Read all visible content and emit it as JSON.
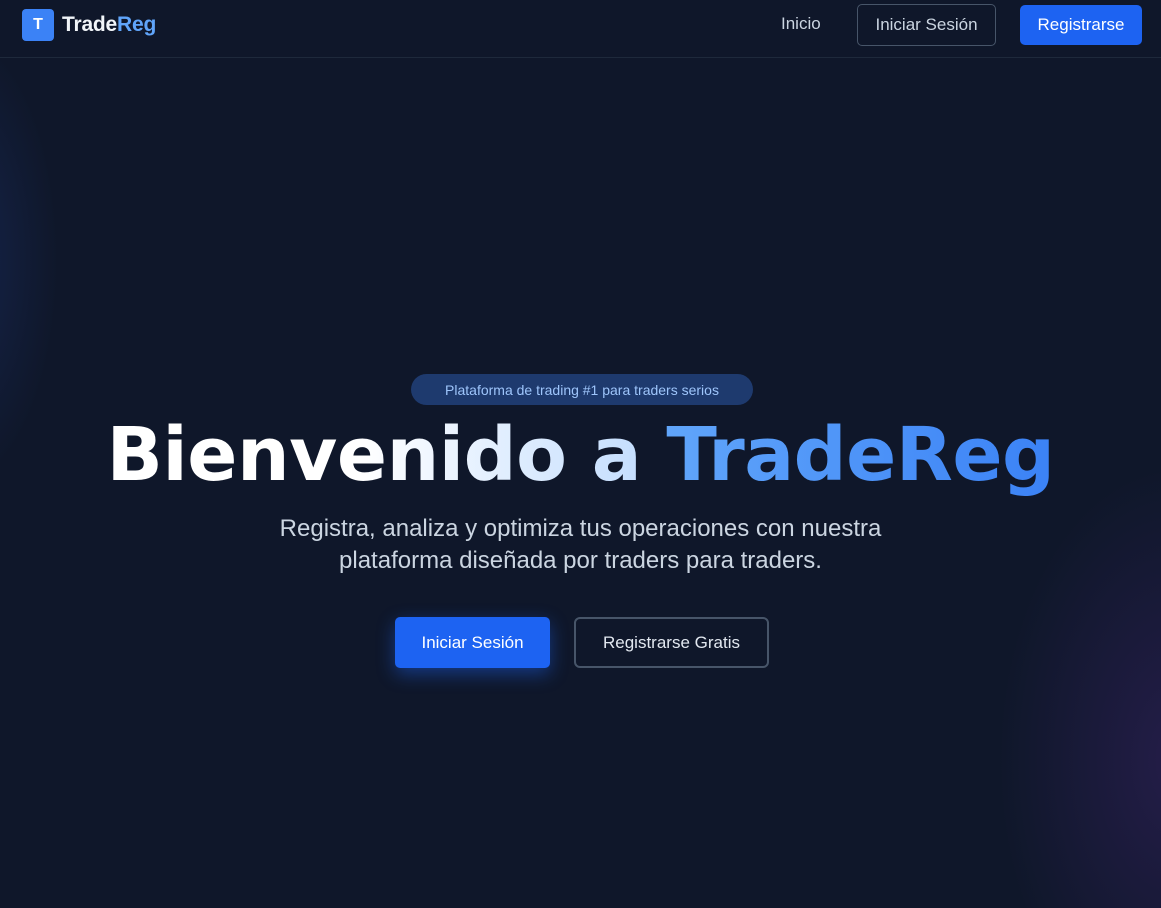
{
  "navbar": {
    "logo_letter": "T",
    "brand_part1": "Trade",
    "brand_part2": "Reg",
    "nav_home": "Inicio",
    "login_label": "Iniciar Sesión",
    "register_label": "Registrarse"
  },
  "hero": {
    "badge": "Plataforma de trading #1 para traders serios",
    "title_part1": "Bienvenido a ",
    "title_part2": "TradeReg",
    "subtitle": "Registra, analiza y optimiza tus operaciones con nuestra plataforma diseñada por traders para traders.",
    "primary_button": "Iniciar Sesión",
    "secondary_button": "Registrarse Gratis"
  },
  "colors": {
    "background": "#0f172a",
    "accent": "#1d63f2",
    "brand_blue": "#60a5fa",
    "badge_bg": "#1e3a6e"
  }
}
